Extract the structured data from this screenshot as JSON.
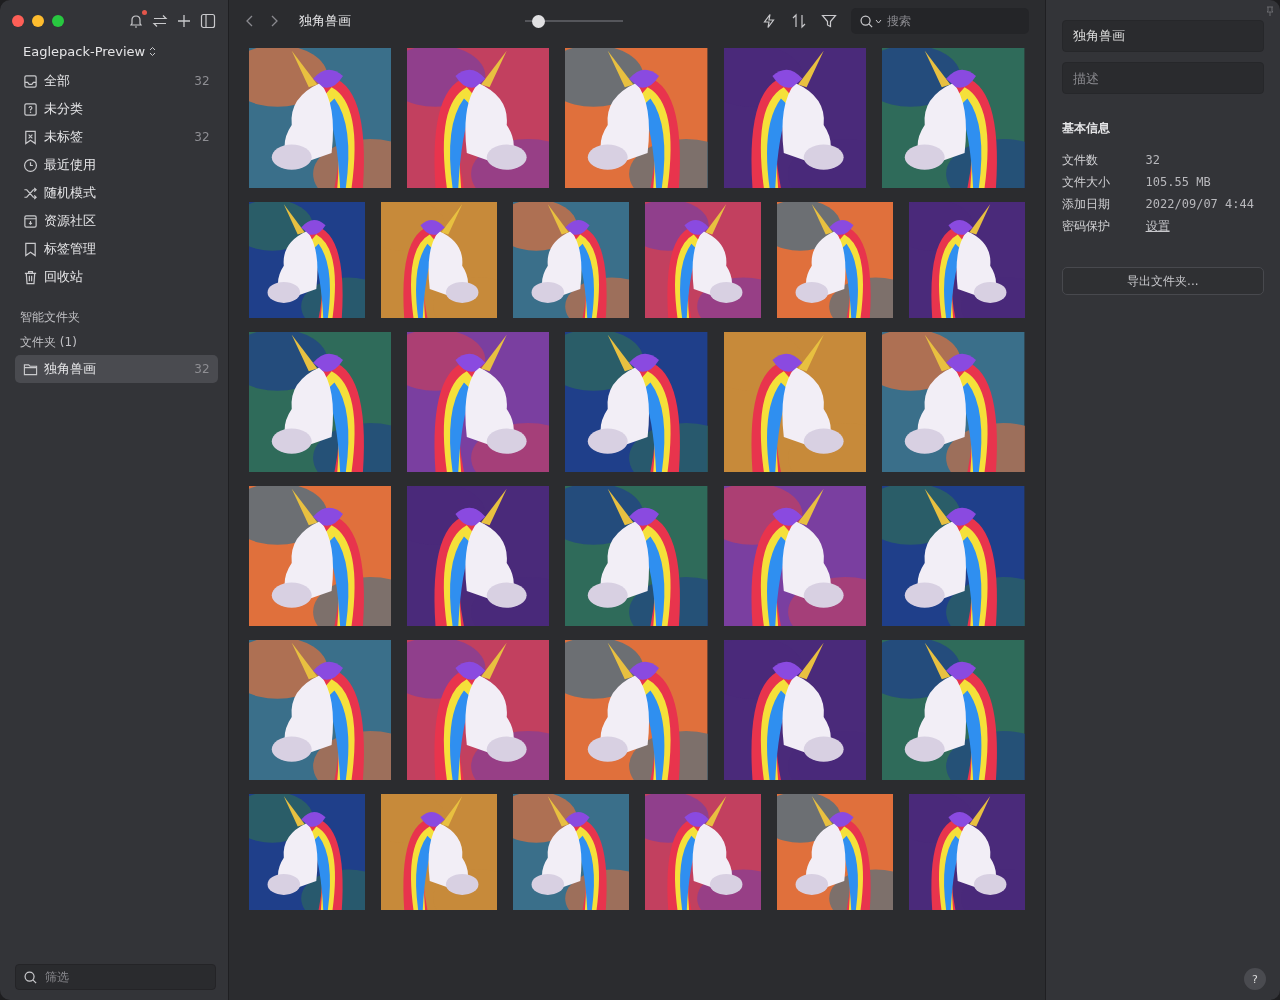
{
  "sidebar": {
    "library": "Eaglepack-Preview",
    "items": [
      {
        "label": "全部",
        "count": "32"
      },
      {
        "label": "未分类"
      },
      {
        "label": "未标签",
        "count": "32"
      },
      {
        "label": "最近使用"
      },
      {
        "label": "随机模式"
      },
      {
        "label": "资源社区"
      },
      {
        "label": "标签管理"
      },
      {
        "label": "回收站"
      }
    ],
    "smart_folders": "智能文件夹",
    "folders_heading": "文件夹 (1)",
    "folders": [
      {
        "label": "独角兽画",
        "count": "32",
        "selected": true
      }
    ],
    "filter": {
      "placeholder": "筛选"
    }
  },
  "toolbar": {
    "title": "独角兽画",
    "zoom": {
      "level": 0.14
    },
    "search": {
      "placeholder": "搜索"
    }
  },
  "inspector": {
    "name": "独角兽画",
    "description": {
      "placeholder": "描述"
    },
    "section": "基本信息",
    "fields": [
      {
        "label": "文件数",
        "value": "32"
      },
      {
        "label": "文件大小",
        "value": "105.55 MB"
      },
      {
        "label": "添加日期",
        "value": "2022/09/07 4:44"
      },
      {
        "label": "密码保护",
        "value": "设置",
        "kind": "link"
      }
    ],
    "export_button": "导出文件夹...",
    "help": "?"
  }
}
